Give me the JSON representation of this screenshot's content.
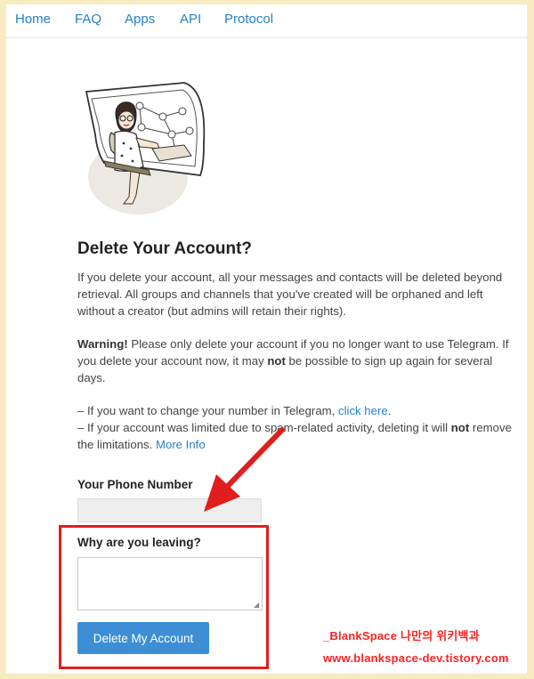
{
  "nav": {
    "items": [
      "Home",
      "FAQ",
      "Apps",
      "API",
      "Protocol"
    ]
  },
  "page": {
    "title": "Delete Your Account?",
    "intro": "If you delete your account, all your messages and contacts will be deleted beyond retrieval. All groups and channels that you've created will be orphaned and left without a creator (but admins will retain their rights).",
    "warning": {
      "strong": "Warning!",
      "text1": " Please only delete your account if you no longer want to use Telegram. If you delete your account now, it may ",
      "not": "not",
      "text2": " be possible to sign up again for several days."
    },
    "note1": {
      "text": "– If you want to change your number in Telegram, ",
      "link": "click here",
      "end": "."
    },
    "note2": {
      "text1": "– If your account was limited due to spam-related activity, deleting it will ",
      "not": "not",
      "text2": " remove the limitations. ",
      "link": "More Info"
    }
  },
  "form": {
    "phone_label": "Your Phone Number",
    "phone_value": "",
    "reason_label": "Why are you leaving?",
    "reason_value": "",
    "submit_label": "Delete My Account"
  },
  "watermark": {
    "line1": "_BlankSpace 나만의 위키백과",
    "line2": "www.blankspace-dev.tistory.com"
  },
  "colors": {
    "accent": "#2481cc",
    "button": "#3d8ed4",
    "annotation": "#e01e1e",
    "background": "#f6ecc0"
  }
}
